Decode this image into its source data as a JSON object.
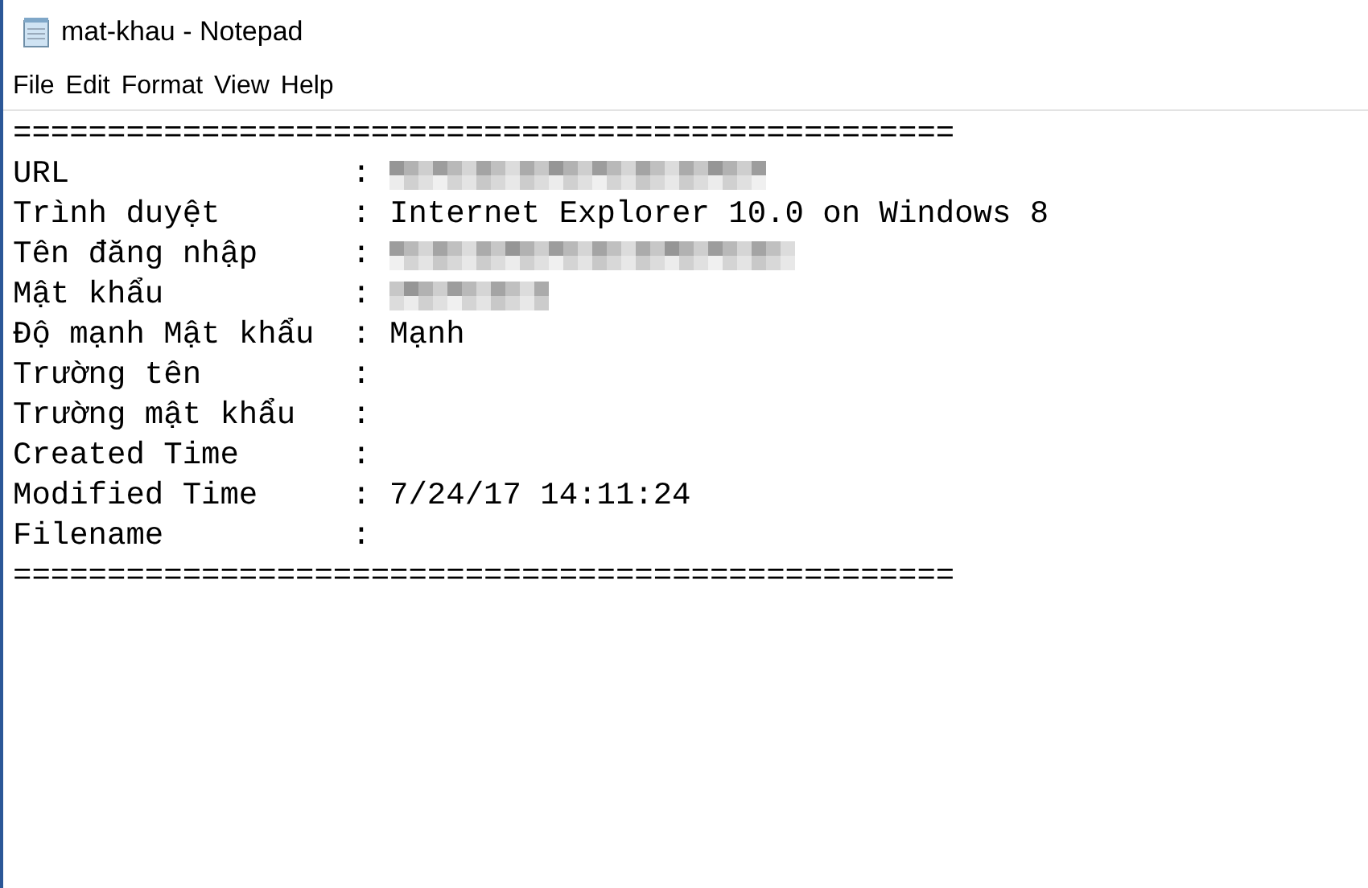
{
  "window": {
    "title": "mat-khau - Notepad"
  },
  "menu": [
    "File",
    "Edit",
    "Format",
    "View",
    "Help"
  ],
  "document": {
    "rule": "==================================================",
    "fields": [
      {
        "label": "URL",
        "separator": ":",
        "redacted": true
      },
      {
        "label": "Trình duyệt",
        "separator": ":",
        "value": "Internet Explorer 10.0 on Windows 8",
        "redacted": false
      },
      {
        "label": "Tên đăng nhập",
        "separator": ":",
        "redacted": true
      },
      {
        "label": "Mật khẩu",
        "separator": ":",
        "redacted": true
      },
      {
        "label": "Độ mạnh Mật khẩu",
        "separator": ":",
        "value": "Mạnh",
        "redacted": false
      },
      {
        "label": "Trường tên",
        "separator": ":",
        "redacted": false
      },
      {
        "label": "Trường mật khẩu",
        "separator": ":",
        "redacted": false
      },
      {
        "label": "Created Time",
        "separator": ":",
        "redacted": false
      },
      {
        "label": "Modified Time",
        "separator": ":",
        "value": "7/24/17 14:11:24",
        "redacted": false
      },
      {
        "label": "Filename",
        "separator": ":",
        "redacted": false
      }
    ]
  }
}
